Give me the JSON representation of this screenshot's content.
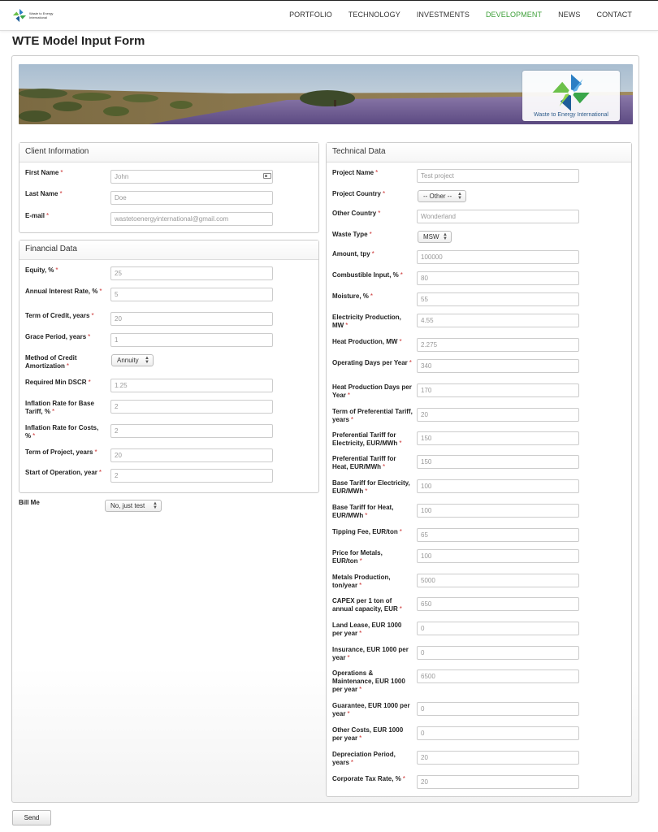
{
  "header": {
    "logo_text": "Waste to Energy International",
    "nav": [
      {
        "label": "PORTFOLIO"
      },
      {
        "label": "TECHNOLOGY"
      },
      {
        "label": "INVESTMENTS"
      },
      {
        "label": "DEVELOPMENT",
        "active": true
      },
      {
        "label": "NEWS"
      },
      {
        "label": "CONTACT"
      }
    ],
    "active_color": "#3c9f37"
  },
  "page_title": "WTE Model Input Form",
  "banner": {
    "brand": "Waste to Energy International"
  },
  "client": {
    "title": "Client Information",
    "fields": [
      {
        "label": "First Name",
        "value": "John"
      },
      {
        "label": "Last Name",
        "value": "Doe"
      },
      {
        "label": "E-mail",
        "value": "wastetoenergyinternational@gmail.com"
      }
    ]
  },
  "financial": {
    "title": "Financial Data",
    "fields": [
      {
        "label": "Equity, %",
        "value": "25"
      },
      {
        "label": "Annual Interest Rate, %",
        "value": "5"
      },
      {
        "label": "Term of Credit, years",
        "value": "20"
      },
      {
        "label": "Grace Period, years",
        "value": "1"
      },
      {
        "label": "Method of Credit Amortization",
        "value": "Annuity"
      },
      {
        "label": "Required Min DSCR",
        "value": "1.25"
      },
      {
        "label": "Inflation Rate for Base Tariff, %",
        "value": "2"
      },
      {
        "label": "Inflation Rate for Costs, %",
        "value": "2"
      },
      {
        "label": "Term of Project, years",
        "value": "20"
      },
      {
        "label": "Start of Operation, year",
        "value": "2"
      }
    ]
  },
  "bill": {
    "label": "Bill Me",
    "value": "No, just test"
  },
  "technical": {
    "title": "Technical Data",
    "fields": [
      {
        "label": "Project Name",
        "value": "Test project"
      },
      {
        "label": "Project Country",
        "value": "-- Other --"
      },
      {
        "label": "Other Country",
        "value": "Wonderland"
      },
      {
        "label": "Waste Type",
        "value": "MSW"
      },
      {
        "label": "Amount, tpy",
        "value": "100000"
      },
      {
        "label": "Combustible Input, %",
        "value": "80"
      },
      {
        "label": "Moisture, %",
        "value": "55"
      },
      {
        "label": "Electricity Production, MW",
        "value": "4.55"
      },
      {
        "label": "Heat Production, MW",
        "value": "2.275"
      },
      {
        "label": "Operating Days per Year",
        "value": "340"
      },
      {
        "label": "Heat Production Days per Year",
        "value": "170"
      },
      {
        "label": "Term of Preferential Tariff, years",
        "value": "20"
      },
      {
        "label": "Preferential Tariff for Electricity, EUR/MWh",
        "value": "150"
      },
      {
        "label": "Preferential Tariff for Heat, EUR/MWh",
        "value": "150"
      },
      {
        "label": "Base Tariff for Electricity, EUR/MWh",
        "value": "100"
      },
      {
        "label": "Base Tariff for Heat, EUR/MWh",
        "value": "100"
      },
      {
        "label": "Tipping Fee, EUR/ton",
        "value": "65"
      },
      {
        "label": "Price for Metals, EUR/ton",
        "value": "100"
      },
      {
        "label": "Metals Production, ton/year",
        "value": "5000"
      },
      {
        "label": "CAPEX per 1 ton of annual capacity, EUR",
        "value": "650"
      },
      {
        "label": "Land Lease, EUR 1000 per year",
        "value": "0"
      },
      {
        "label": "Insurance, EUR 1000 per year",
        "value": "0"
      },
      {
        "label": "Operations & Maintenance, EUR 1000 per year",
        "value": "6500"
      },
      {
        "label": "Guarantee, EUR 1000 per year",
        "value": "0"
      },
      {
        "label": "Other Costs, EUR 1000 per year",
        "value": "0"
      },
      {
        "label": "Depreciation Period, years",
        "value": "20"
      },
      {
        "label": "Corporate Tax Rate, %",
        "value": "20"
      }
    ]
  },
  "send_label": "Send"
}
